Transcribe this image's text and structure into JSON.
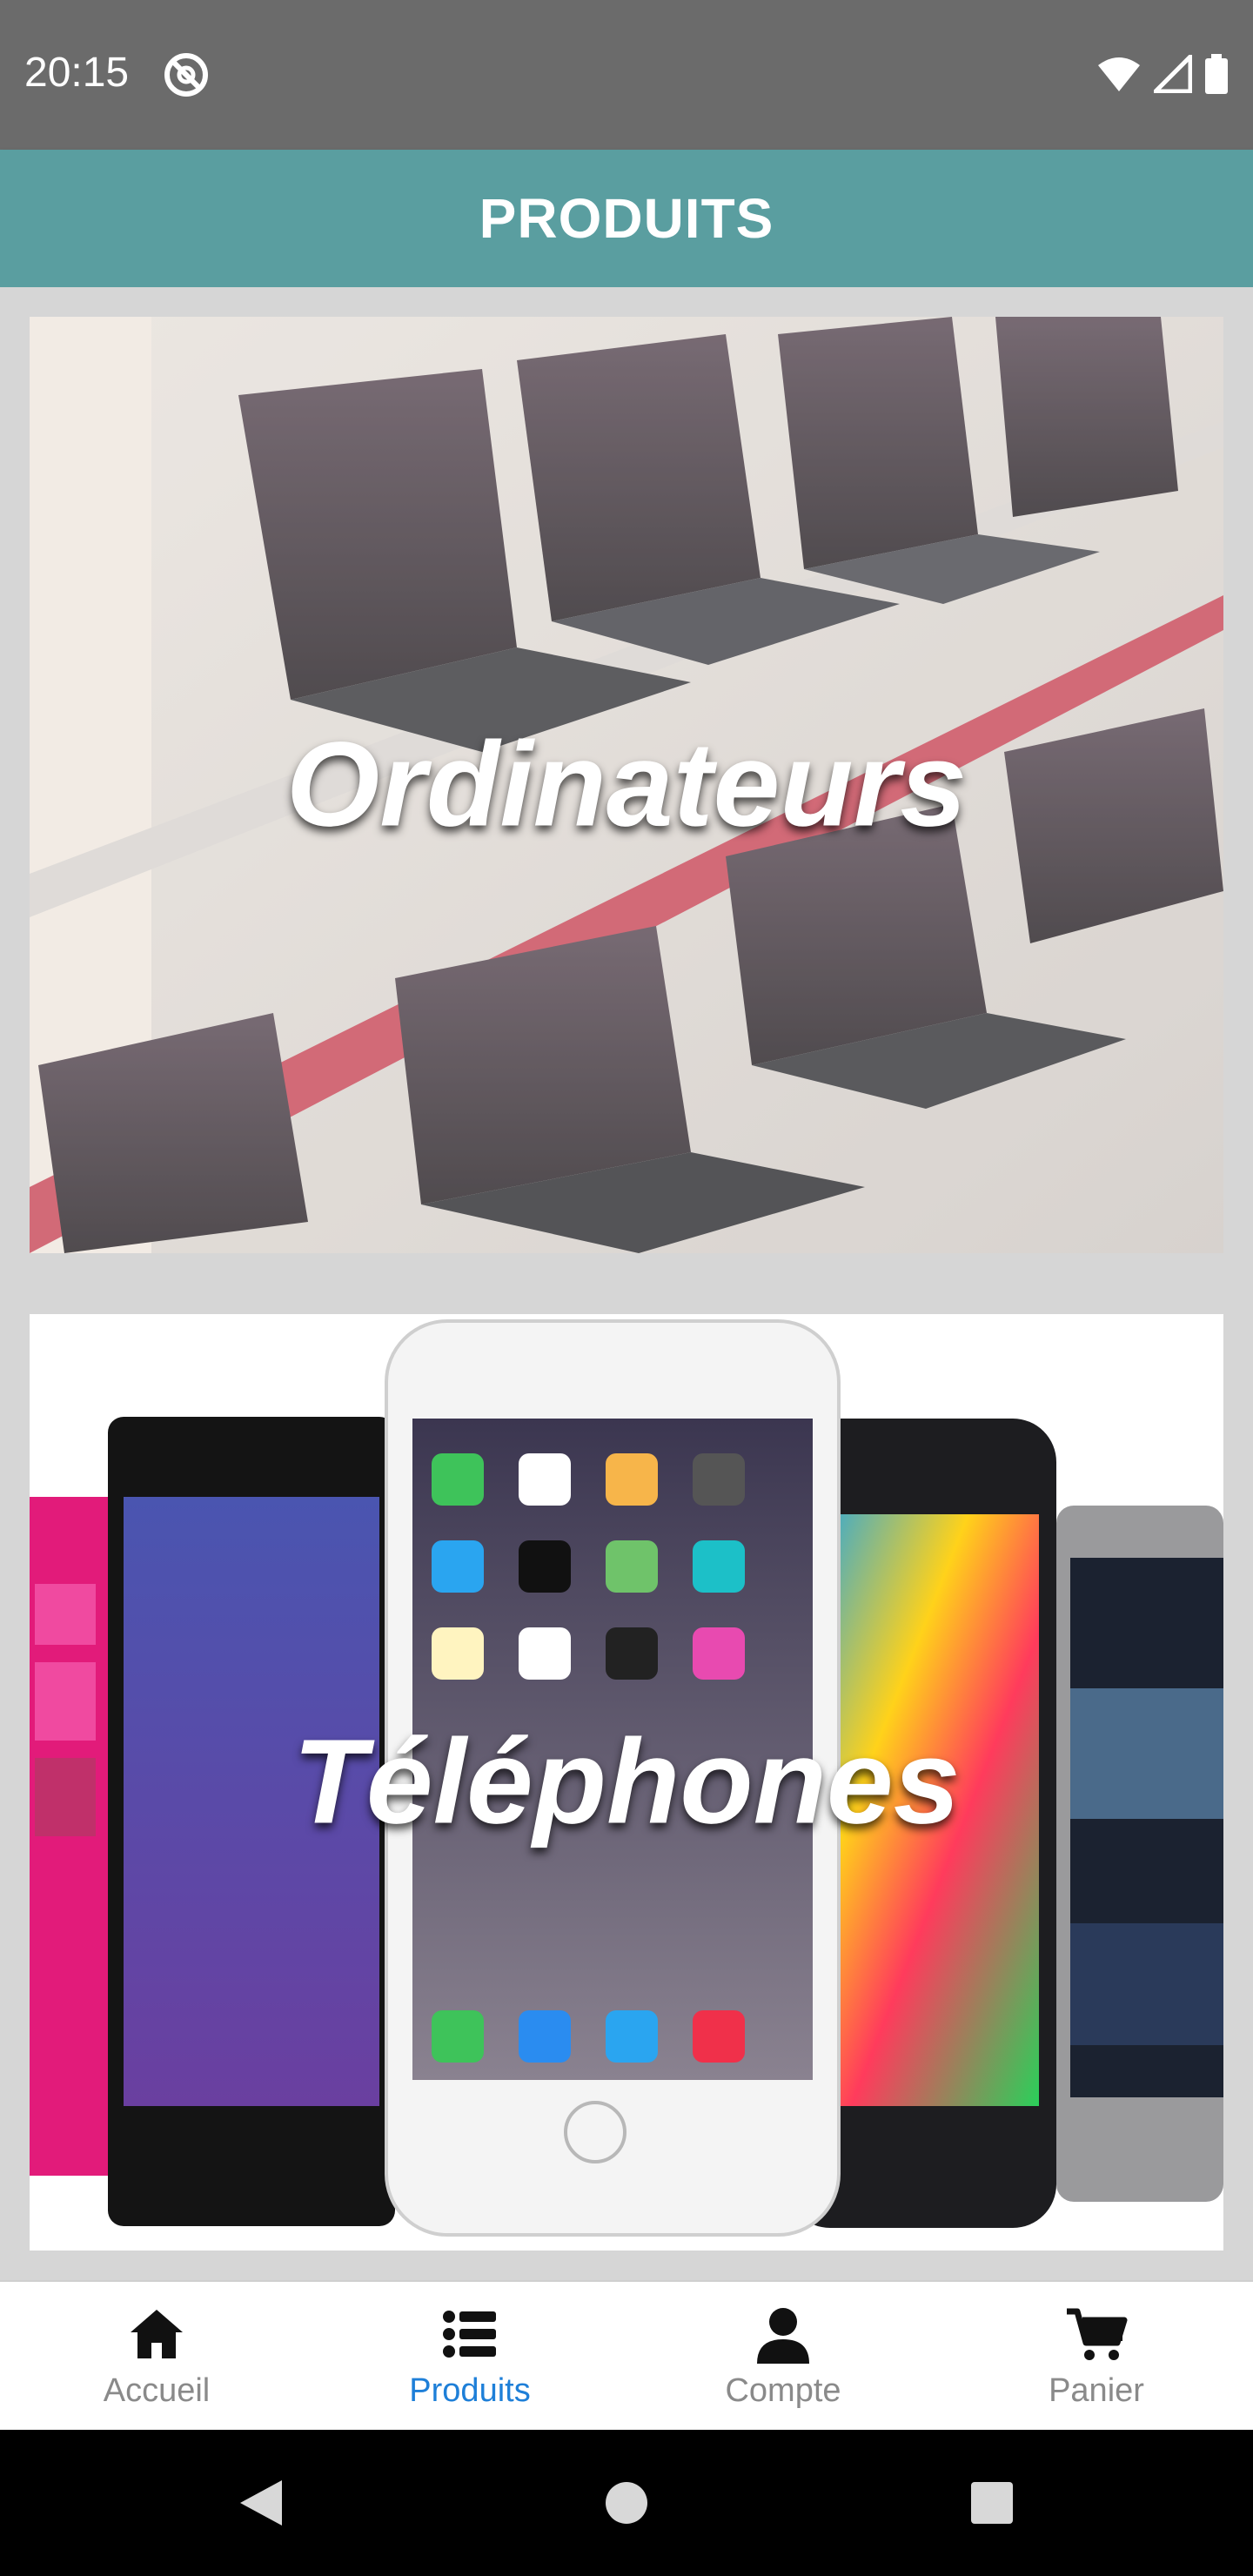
{
  "status_bar": {
    "time": "20:15"
  },
  "app_bar": {
    "title": "PRODUITS"
  },
  "categories": [
    {
      "label": "Ordinateurs"
    },
    {
      "label": "Téléphones"
    }
  ],
  "bottom_nav": {
    "items": [
      {
        "label": "Accueil",
        "icon": "home-icon",
        "active": false
      },
      {
        "label": "Produits",
        "icon": "list-icon",
        "active": true
      },
      {
        "label": "Compte",
        "icon": "user-icon",
        "active": false
      },
      {
        "label": "Panier",
        "icon": "cart-icon",
        "active": false
      }
    ]
  },
  "colors": {
    "app_bar": "#5a9ea0",
    "active_tab": "#1e7fd8",
    "status_bar": "#6b6b6b"
  }
}
